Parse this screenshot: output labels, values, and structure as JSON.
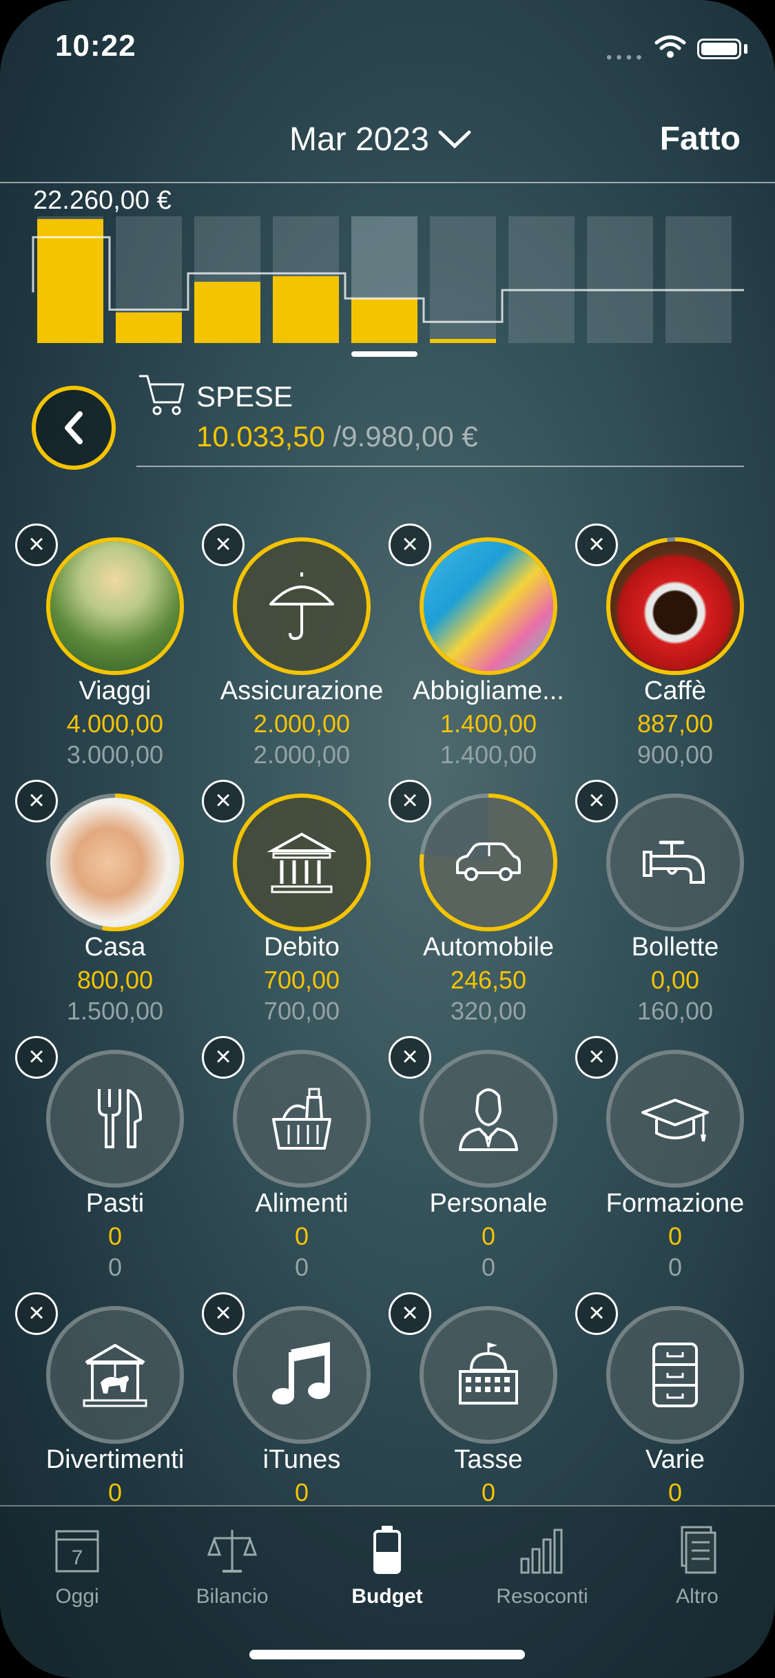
{
  "status_bar": {
    "time": "10:22"
  },
  "navbar": {
    "month": "Mar 2023",
    "done": "Fatto"
  },
  "chart_data": {
    "type": "bar",
    "max_label": "22.260,00 €",
    "values": [
      22260,
      5500,
      11000,
      12000,
      8000,
      700,
      0,
      0,
      0
    ],
    "budgets": [
      19000,
      6000,
      12500,
      12500,
      8000,
      3800,
      9500,
      9500,
      9500
    ],
    "ylim": [
      0,
      22260
    ],
    "selected_index": 4
  },
  "category": {
    "title": "SPESE",
    "spent": "10.033,50",
    "budget": "/9.980,00 €"
  },
  "categories": [
    {
      "name": "Viaggi",
      "spent": "4.000,00",
      "budget": "3.000,00",
      "icon": "photo-temple",
      "progress": 1.0
    },
    {
      "name": "Assicurazione",
      "spent": "2.000,00",
      "budget": "2.000,00",
      "icon": "umbrella-icon",
      "progress": 1.0
    },
    {
      "name": "Abbigliame...",
      "spent": "1.400,00",
      "budget": "1.400,00",
      "icon": "photo-shopping",
      "progress": 1.0
    },
    {
      "name": "Caffè",
      "spent": "887,00",
      "budget": "900,00",
      "icon": "photo-coffee",
      "progress": 0.98
    },
    {
      "name": "Casa",
      "spent": "800,00",
      "budget": "1.500,00",
      "icon": "photo-family",
      "progress": 0.53
    },
    {
      "name": "Debito",
      "spent": "700,00",
      "budget": "700,00",
      "icon": "bank-icon",
      "progress": 1.0
    },
    {
      "name": "Automobile",
      "spent": "246,50",
      "budget": "320,00",
      "icon": "car-icon",
      "progress": 0.77
    },
    {
      "name": "Bollette",
      "spent": "0,00",
      "budget": "160,00",
      "icon": "faucet-icon",
      "progress": 0
    },
    {
      "name": "Pasti",
      "spent": "0",
      "budget": "0",
      "icon": "cutlery-icon",
      "progress": 0
    },
    {
      "name": "Alimenti",
      "spent": "0",
      "budget": "0",
      "icon": "groceries-icon",
      "progress": 0
    },
    {
      "name": "Personale",
      "spent": "0",
      "budget": "0",
      "icon": "person-icon",
      "progress": 0
    },
    {
      "name": "Formazione",
      "spent": "0",
      "budget": "0",
      "icon": "graduation-cap-icon",
      "progress": 0
    },
    {
      "name": "Divertimenti",
      "spent": "0",
      "budget": "",
      "icon": "carousel-icon",
      "progress": 0
    },
    {
      "name": "iTunes",
      "spent": "0",
      "budget": "",
      "icon": "music-note-icon",
      "progress": 0
    },
    {
      "name": "Tasse",
      "spent": "0",
      "budget": "",
      "icon": "government-building-icon",
      "progress": 0
    },
    {
      "name": "Varie",
      "spent": "0",
      "budget": "",
      "icon": "drawers-icon",
      "progress": 0
    }
  ],
  "tabbar": {
    "tabs": [
      {
        "label": "Oggi",
        "icon": "calendar-icon",
        "badge": "7"
      },
      {
        "label": "Bilancio",
        "icon": "scales-icon"
      },
      {
        "label": "Budget",
        "icon": "battery-icon",
        "active": true
      },
      {
        "label": "Resoconti",
        "icon": "bar-chart-icon"
      },
      {
        "label": "Altro",
        "icon": "document-icon"
      }
    ]
  },
  "colors": {
    "accent": "#f5c400",
    "muted": "#95a3a6"
  }
}
